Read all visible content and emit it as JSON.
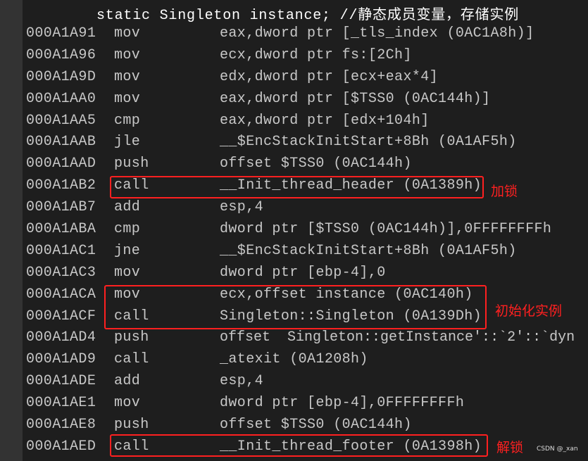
{
  "source_line": "static Singleton instance; //静态成员变量，存储实例",
  "rows": [
    {
      "addr": "000A1A91",
      "mn": "mov",
      "op": "eax,dword ptr [_tls_index (0AC1A8h)]"
    },
    {
      "addr": "000A1A96",
      "mn": "mov",
      "op": "ecx,dword ptr fs:[2Ch]"
    },
    {
      "addr": "000A1A9D",
      "mn": "mov",
      "op": "edx,dword ptr [ecx+eax*4]"
    },
    {
      "addr": "000A1AA0",
      "mn": "mov",
      "op": "eax,dword ptr [$TSS0 (0AC144h)]"
    },
    {
      "addr": "000A1AA5",
      "mn": "cmp",
      "op": "eax,dword ptr [edx+104h]"
    },
    {
      "addr": "000A1AAB",
      "mn": "jle",
      "op": "__$EncStackInitStart+8Bh (0A1AF5h)"
    },
    {
      "addr": "000A1AAD",
      "mn": "push",
      "op": "offset $TSS0 (0AC144h)"
    },
    {
      "addr": "000A1AB2",
      "mn": "call",
      "op": "__Init_thread_header (0A1389h)"
    },
    {
      "addr": "000A1AB7",
      "mn": "add",
      "op": "esp,4"
    },
    {
      "addr": "000A1ABA",
      "mn": "cmp",
      "op": "dword ptr [$TSS0 (0AC144h)],0FFFFFFFFh"
    },
    {
      "addr": "000A1AC1",
      "mn": "jne",
      "op": "__$EncStackInitStart+8Bh (0A1AF5h)"
    },
    {
      "addr": "000A1AC3",
      "mn": "mov",
      "op": "dword ptr [ebp-4],0"
    },
    {
      "addr": "000A1ACA",
      "mn": "mov",
      "op": "ecx,offset instance (0AC140h)"
    },
    {
      "addr": "000A1ACF",
      "mn": "call",
      "op": "Singleton::Singleton (0A139Dh)"
    },
    {
      "addr": "000A1AD4",
      "mn": "push",
      "op": "offset  Singleton::getInstance'::`2'::`dyn"
    },
    {
      "addr": "000A1AD9",
      "mn": "call",
      "op": "_atexit (0A1208h)"
    },
    {
      "addr": "000A1ADE",
      "mn": "add",
      "op": "esp,4"
    },
    {
      "addr": "000A1AE1",
      "mn": "mov",
      "op": "dword ptr [ebp-4],0FFFFFFFFh"
    },
    {
      "addr": "000A1AE8",
      "mn": "push",
      "op": "offset $TSS0 (0AC144h)"
    },
    {
      "addr": "000A1AED",
      "mn": "call",
      "op": "__Init_thread_footer (0A1398h)"
    }
  ],
  "annotations": {
    "lock": "加锁",
    "init_instance": "初始化实例",
    "unlock": "解锁"
  },
  "watermark": "CSDN @_xan",
  "colors": {
    "background": "#1e1e1e",
    "text": "#c8c8c8",
    "annotation": "#ff2020"
  }
}
